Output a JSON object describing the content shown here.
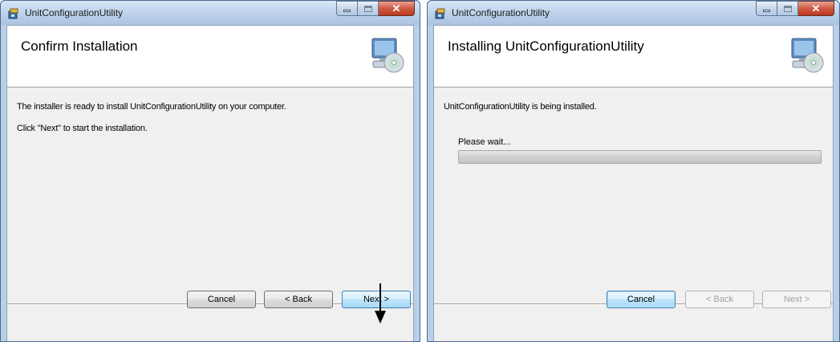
{
  "left_window": {
    "title": "UnitConfigurationUtility",
    "heading": "Confirm Installation",
    "line1": "The installer is ready to install UnitConfigurationUtility on your computer.",
    "line2": "Click \"Next\" to start the installation.",
    "buttons": {
      "cancel": "Cancel",
      "back": "< Back",
      "next": "Next >"
    }
  },
  "right_window": {
    "title": "UnitConfigurationUtility",
    "heading": "Installing UnitConfigurationUtility",
    "status": "UnitConfigurationUtility is being installed.",
    "progress_label": "Please wait...",
    "progress": 0,
    "buttons": {
      "cancel": "Cancel",
      "back": "< Back",
      "next": "Next >"
    }
  },
  "colors": {
    "titlebar": "#bcd2ea",
    "close_button": "#cf5a43",
    "client_bg": "#f0f0f0",
    "focus_button": "#bee6fd"
  },
  "icons": [
    "installer-app-icon",
    "computer-cd-icon",
    "down-arrow-annotation"
  ]
}
